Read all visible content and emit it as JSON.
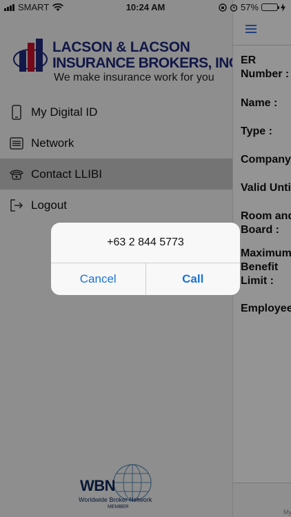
{
  "status_bar": {
    "carrier": "SMART",
    "time": "10:24 AM",
    "battery": "57%",
    "battery_level": 0.57
  },
  "drawer": {
    "logo": {
      "line1": "LACSON & LACSON",
      "line2": "INSURANCE BROKERS, INC.",
      "tagline": "We make insurance work for you"
    },
    "menu": [
      {
        "label": "My Digital ID",
        "icon": "phone-icon"
      },
      {
        "label": "Network",
        "icon": "list-icon"
      },
      {
        "label": "Contact LLIBI",
        "icon": "telephone-icon"
      },
      {
        "label": "Logout",
        "icon": "logout-icon"
      }
    ],
    "active_index": 2,
    "partner": {
      "logo": "WBN",
      "name": "Worldwide Broker Network",
      "member": "MEMBER"
    }
  },
  "main": {
    "fields": [
      "ER",
      "Number :",
      "Name :",
      "Type :",
      "Company",
      "Valid Unti",
      "Room and",
      "Board :",
      "Maximum",
      "Benefit",
      "Limit :",
      "Employee"
    ],
    "bottom_label": "My"
  },
  "alert": {
    "message": "+63 2 844 5773",
    "cancel_label": "Cancel",
    "call_label": "Call"
  },
  "colors": {
    "accent": "#1a73d9",
    "brand": "#1f2a7a"
  }
}
